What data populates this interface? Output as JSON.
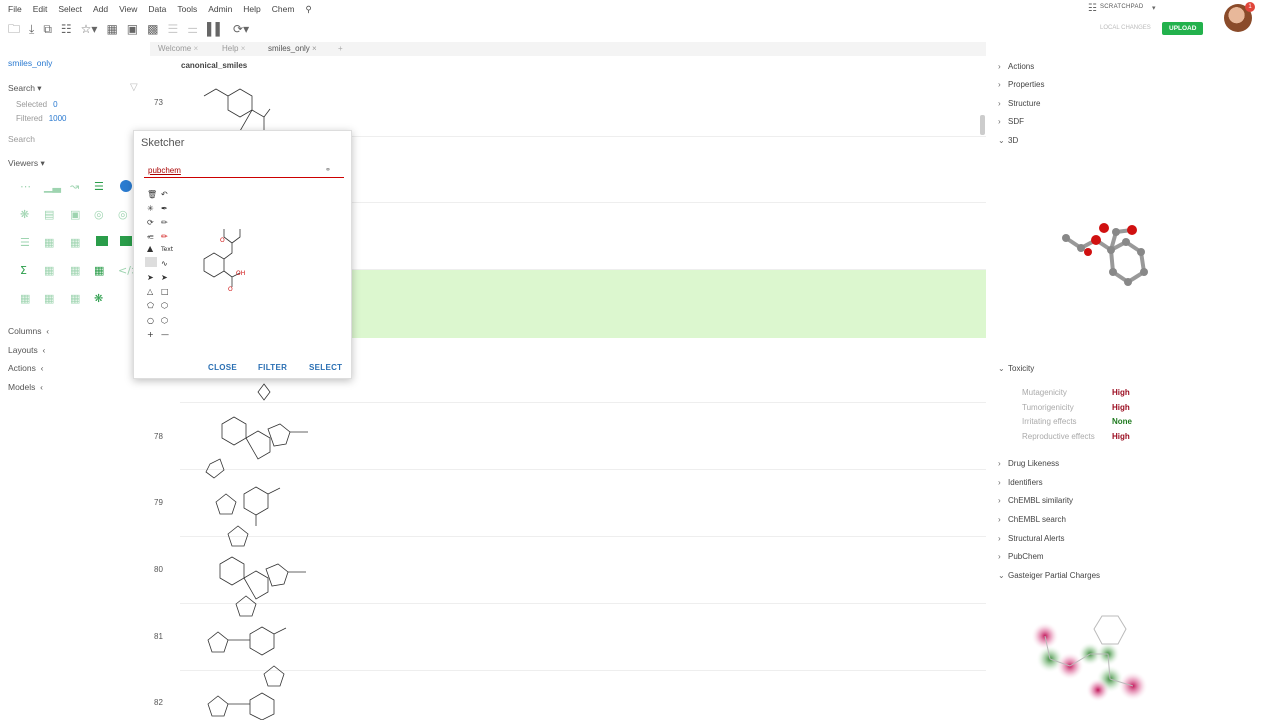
{
  "menu": [
    "File",
    "Edit",
    "Select",
    "Add",
    "View",
    "Data",
    "Tools",
    "Admin",
    "Help",
    "Chem"
  ],
  "topright": {
    "scratchpad": "SCRATCHPAD",
    "local_changes": "LOCAL CHANGES",
    "upload": "UPLOAD",
    "notifications": "1"
  },
  "left": {
    "table_name": "smiles_only",
    "search": "Search",
    "selected_label": "Selected",
    "selected_value": "0",
    "filtered_label": "Filtered",
    "filtered_value": "1000",
    "search_sub": "Search",
    "viewers": "Viewers",
    "columns": "Columns",
    "layouts": "Layouts",
    "actions": "Actions",
    "models": "Models"
  },
  "tabs": [
    "Welcome",
    "Help",
    "smiles_only"
  ],
  "grid": {
    "column": "canonical_smiles",
    "rows": [
      "73",
      "78",
      "79",
      "80",
      "81",
      "82"
    ]
  },
  "right": {
    "sections_top": [
      "Actions",
      "Properties",
      "Structure",
      "SDF",
      "3D"
    ],
    "toxicity": "Toxicity",
    "tox_rows": [
      {
        "label": "Mutagenicity",
        "value": "High",
        "color": "#9a0a1e"
      },
      {
        "label": "Tumorigenicity",
        "value": "High",
        "color": "#9a0a1e"
      },
      {
        "label": "Irritating effects",
        "value": "None",
        "color": "#1f7a1f"
      },
      {
        "label": "Reproductive effects",
        "value": "High",
        "color": "#9a0a1e"
      }
    ],
    "sections_bottom": [
      "Drug Likeness",
      "Identifiers",
      "ChEMBL similarity",
      "ChEMBL search",
      "Structural Alerts",
      "PubChem",
      "Gasteiger Partial Charges"
    ]
  },
  "sketcher": {
    "title": "Sketcher",
    "input_value": "pubchem",
    "close": "CLOSE",
    "filter": "FILTER",
    "select": "SELECT"
  },
  "colors": {
    "accent": "#2979d0",
    "upload": "#22b14c",
    "highlight": "#dcf7cf"
  }
}
